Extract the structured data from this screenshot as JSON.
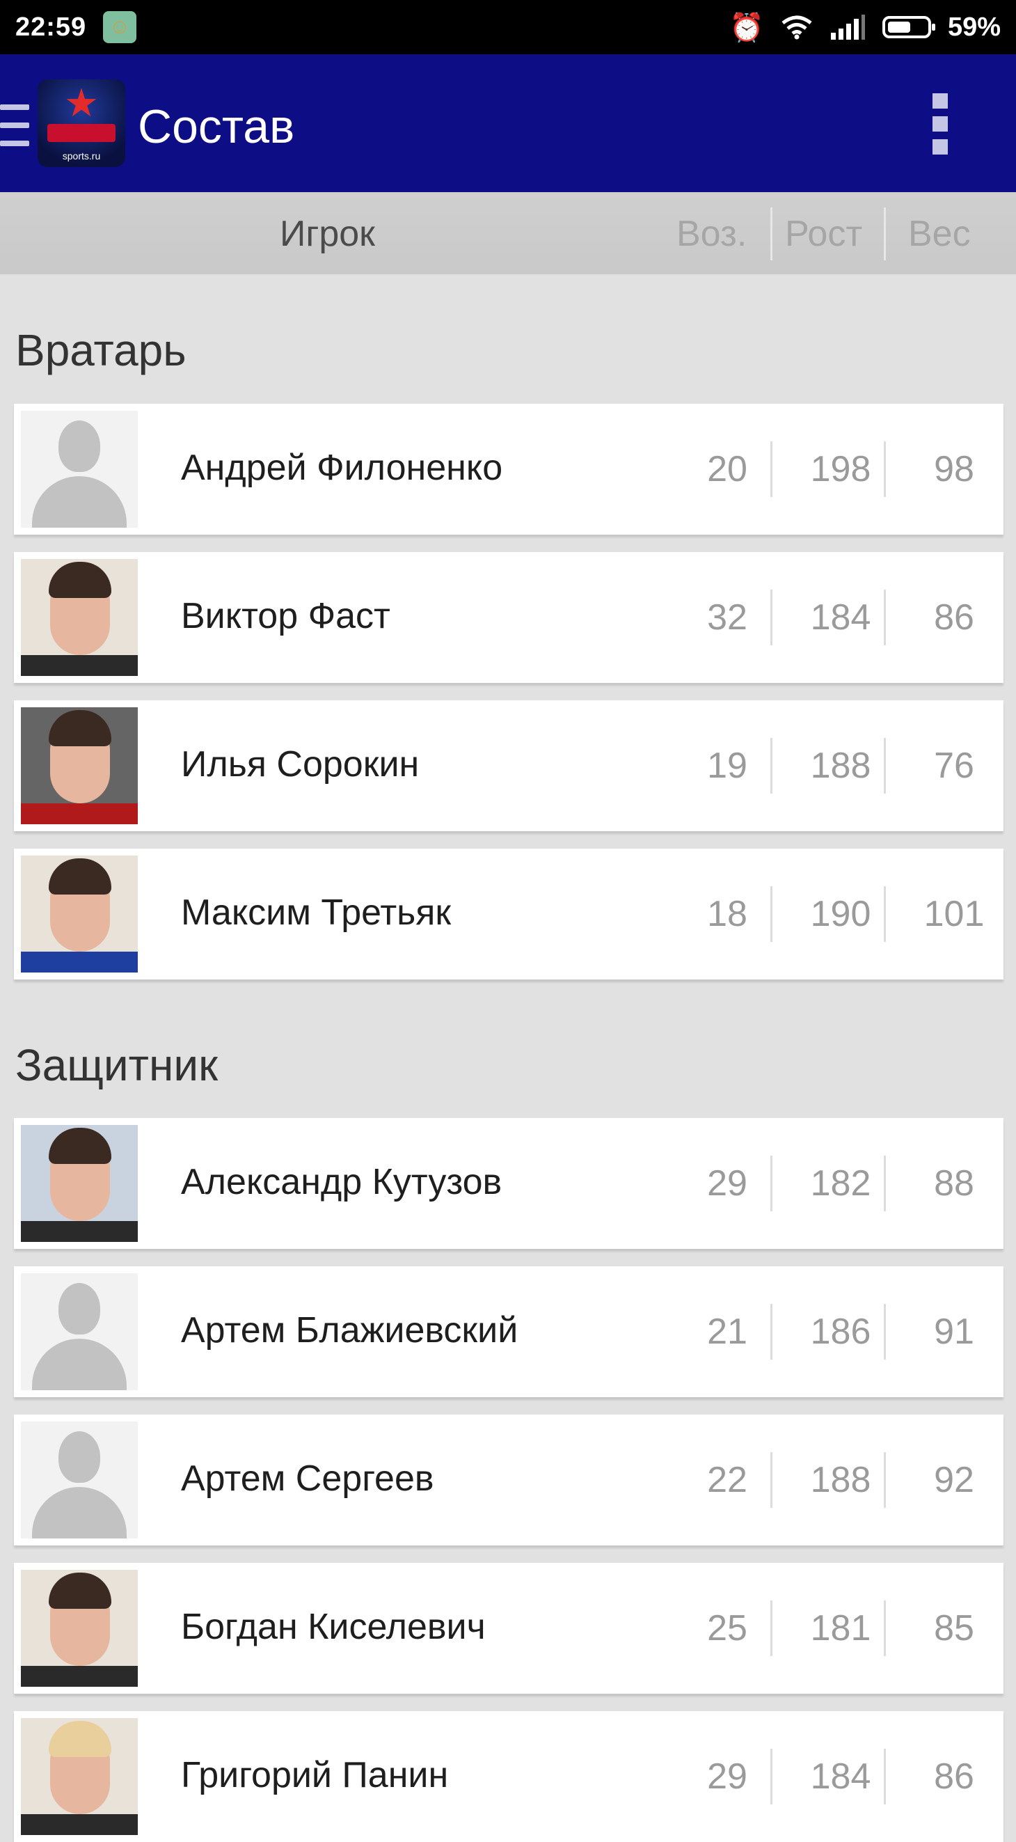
{
  "status_bar": {
    "time": "22:59",
    "battery": "59%"
  },
  "app_bar": {
    "title": "Состав",
    "logo_text": "sports.ru"
  },
  "columns": {
    "player": "Игрок",
    "age": "Воз.",
    "height": "Рост",
    "weight": "Вес"
  },
  "sections": [
    {
      "title": "Вратарь",
      "players": [
        {
          "name": "Андрей Филоненко",
          "age": "20",
          "height": "198",
          "weight": "98"
        },
        {
          "name": "Виктор Фаст",
          "age": "32",
          "height": "184",
          "weight": "86"
        },
        {
          "name": "Илья Сорокин",
          "age": "19",
          "height": "188",
          "weight": "76"
        },
        {
          "name": "Максим Третьяк",
          "age": "18",
          "height": "190",
          "weight": "101"
        }
      ]
    },
    {
      "title": "Защитник",
      "players": [
        {
          "name": "Александр Кутузов",
          "age": "29",
          "height": "182",
          "weight": "88"
        },
        {
          "name": "Артем Блажиевский",
          "age": "21",
          "height": "186",
          "weight": "91"
        },
        {
          "name": "Артем Сергеев",
          "age": "22",
          "height": "188",
          "weight": "92"
        },
        {
          "name": "Богдан Киселевич",
          "age": "25",
          "height": "181",
          "weight": "85"
        },
        {
          "name": "Григорий Панин",
          "age": "29",
          "height": "184",
          "weight": "86"
        }
      ]
    }
  ]
}
